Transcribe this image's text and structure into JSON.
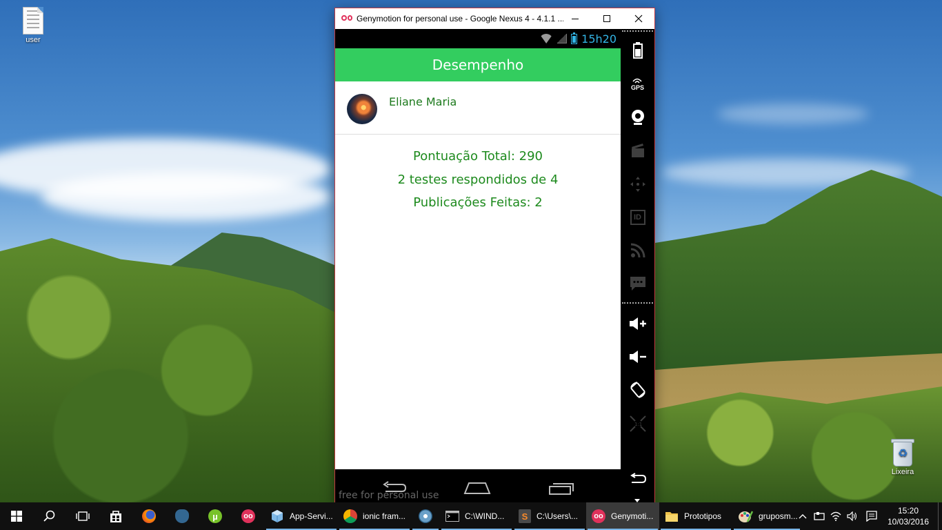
{
  "desktop": {
    "icons": [
      {
        "label": "user"
      },
      {
        "label": "Lixeira"
      }
    ]
  },
  "window": {
    "title": "Genymotion for personal use - Google Nexus 4 - 4.1.1 ...",
    "frame_color": "#c4393f"
  },
  "phone": {
    "status": {
      "time": "15h20",
      "accent": "#33b5e5"
    },
    "app": {
      "header_title": "Desempenho",
      "header_color": "#33cd5f",
      "user_name": "Eliane Maria",
      "stats": [
        "Pontuação Total: 290",
        "2 testes respondidos de 4",
        "Publicações Feitas: 2"
      ],
      "text_color": "#1d8a1d"
    },
    "watermark": "free for personal use"
  },
  "genymotion_toolbar": {
    "tools": [
      "battery-icon",
      "gps-icon",
      "camera-icon",
      "video-icon",
      "dpad-icon",
      "id-icon",
      "rss-icon",
      "sms-icon",
      "volume-up-icon",
      "volume-down-icon",
      "rotate-icon",
      "scale-icon",
      "back-icon"
    ],
    "gps_label": "GPS",
    "id_label": "ID"
  },
  "taskbar": {
    "tasks": [
      {
        "label": "App-Servi...",
        "icon": "app-cube-icon"
      },
      {
        "label": "ionic fram...",
        "icon": "chrome-icon"
      },
      {
        "label": "C:\\WIND...",
        "icon": "cmd-icon"
      },
      {
        "label": "C:\\Users\\...",
        "icon": "sublime-icon"
      },
      {
        "label": "Genymoti...",
        "icon": "genymotion-icon"
      },
      {
        "label": "Prototipos",
        "icon": "folder-icon"
      },
      {
        "label": "gruposm...",
        "icon": "paint-icon"
      }
    ],
    "clock": {
      "time": "15:20",
      "date": "10/03/2016"
    }
  }
}
